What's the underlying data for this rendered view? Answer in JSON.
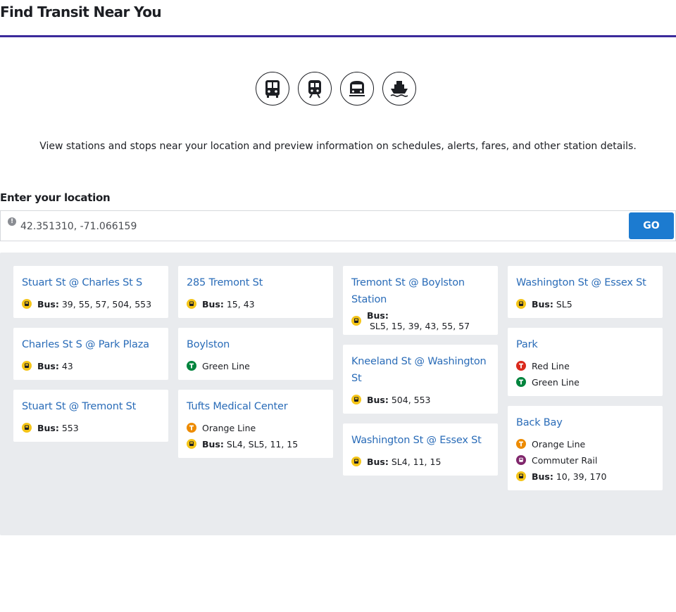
{
  "header": {
    "title": "Find Transit Near You"
  },
  "modes": [
    {
      "icon": "bus-icon"
    },
    {
      "icon": "subway-icon"
    },
    {
      "icon": "commuter-rail-icon"
    },
    {
      "icon": "ferry-icon"
    }
  ],
  "intro": "View stations and stops near your location and preview information on schedules, alerts, fares, and other station details.",
  "location": {
    "label": "Enter your location",
    "value": "42.351310, -71.066159",
    "info_icon": "info-icon",
    "go_label": "GO"
  },
  "colors": {
    "accent": "#3b2a9b",
    "link": "#2a6cb8",
    "button": "#1c7bd0",
    "panel_bg": "#e9ebee",
    "bus": "#f5c518",
    "green_line": "#00843d",
    "red_line": "#da291c",
    "orange_line": "#ed8b00",
    "commuter_rail": "#80276c"
  },
  "columns": [
    [
      {
        "name": "Stuart St @ Charles St S",
        "routes": [
          {
            "type": "bus",
            "prefix": "Bus:",
            "text": " 39, 55, 57, 504, 553"
          }
        ]
      },
      {
        "name": "Charles St S @ Park Plaza",
        "routes": [
          {
            "type": "bus",
            "prefix": "Bus:",
            "text": " 43"
          }
        ]
      },
      {
        "name": "Stuart St @ Tremont St",
        "routes": [
          {
            "type": "bus",
            "prefix": "Bus:",
            "text": " 553"
          }
        ]
      }
    ],
    [
      {
        "name": "285 Tremont St",
        "routes": [
          {
            "type": "bus",
            "prefix": "Bus:",
            "text": " 15, 43"
          }
        ]
      },
      {
        "name": "Boylston",
        "routes": [
          {
            "type": "green",
            "prefix": "",
            "text": "Green Line"
          }
        ]
      },
      {
        "name": "Tufts Medical Center",
        "routes": [
          {
            "type": "orange",
            "prefix": "",
            "text": "Orange Line"
          },
          {
            "type": "bus",
            "prefix": "Bus:",
            "text": " SL4, SL5, 11, 15"
          }
        ]
      }
    ],
    [
      {
        "name": "Tremont St @ Boylston Station",
        "routes": [
          {
            "type": "bus",
            "prefix": "Bus:",
            "text": " SL5, 15, 39, 43, 55, 57"
          }
        ]
      },
      {
        "name": "Kneeland St @ Washington St",
        "routes": [
          {
            "type": "bus",
            "prefix": "Bus:",
            "text": " 504, 553"
          }
        ]
      },
      {
        "name": "Washington St @ Essex St",
        "routes": [
          {
            "type": "bus",
            "prefix": "Bus:",
            "text": " SL4, 11, 15"
          }
        ]
      }
    ],
    [
      {
        "name": "Washington St @ Essex St",
        "routes": [
          {
            "type": "bus",
            "prefix": "Bus:",
            "text": " SL5"
          }
        ]
      },
      {
        "name": "Park",
        "routes": [
          {
            "type": "red",
            "prefix": "",
            "text": "Red Line"
          },
          {
            "type": "green",
            "prefix": "",
            "text": "Green Line"
          }
        ]
      },
      {
        "name": "Back Bay",
        "routes": [
          {
            "type": "orange",
            "prefix": "",
            "text": "Orange Line"
          },
          {
            "type": "rail",
            "prefix": "",
            "text": "Commuter Rail"
          },
          {
            "type": "bus",
            "prefix": "Bus:",
            "text": " 10, 39, 170"
          }
        ]
      }
    ]
  ]
}
